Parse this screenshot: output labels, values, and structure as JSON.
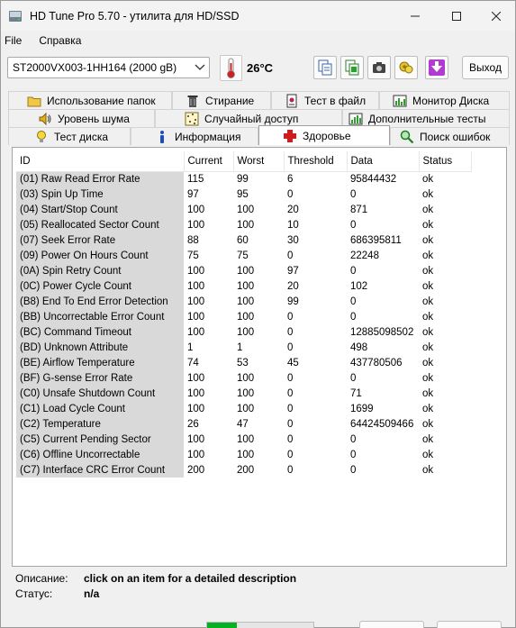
{
  "window": {
    "title": "HD Tune Pro 5.70 - утилита для HD/SSD"
  },
  "menu": {
    "file": "File",
    "help": "Справка"
  },
  "toolbar": {
    "drive": "ST2000VX003-1HH164 (2000 gB)",
    "temperature": "26°C",
    "exit_label": "Выход",
    "icons": [
      "copy-text-icon",
      "copy-screen-icon",
      "camera-icon",
      "options-icon",
      "save-down-icon"
    ]
  },
  "tabs": {
    "row1": [
      {
        "label": "Использование папок",
        "icon": "folder-icon"
      },
      {
        "label": "Стирание",
        "icon": "trash-icon"
      },
      {
        "label": "Тест в файл",
        "icon": "file-test-icon"
      },
      {
        "label": "Монитор Диска",
        "icon": "disk-monitor-icon"
      }
    ],
    "row2": [
      {
        "label": "Уровень шума",
        "icon": "speaker-icon"
      },
      {
        "label": "Случайный доступ",
        "icon": "random-access-icon"
      },
      {
        "label": "Дополнительные тесты",
        "icon": "extra-tests-icon"
      }
    ],
    "row3": [
      {
        "label": "Тест диска",
        "icon": "bulb-icon"
      },
      {
        "label": "Информация",
        "icon": "info-icon"
      },
      {
        "label": "Здоровье",
        "icon": "health-cross-icon"
      },
      {
        "label": "Поиск ошибок",
        "icon": "magnifier-icon"
      }
    ],
    "active": "Здоровье"
  },
  "smart": {
    "columns": [
      "ID",
      "Current",
      "Worst",
      "Threshold",
      "Data",
      "Status"
    ],
    "rows": [
      [
        "(01) Raw Read Error Rate",
        "115",
        "99",
        "6",
        "95844432",
        "ok"
      ],
      [
        "(03) Spin Up Time",
        "97",
        "95",
        "0",
        "0",
        "ok"
      ],
      [
        "(04) Start/Stop Count",
        "100",
        "100",
        "20",
        "871",
        "ok"
      ],
      [
        "(05) Reallocated Sector Count",
        "100",
        "100",
        "10",
        "0",
        "ok"
      ],
      [
        "(07) Seek Error Rate",
        "88",
        "60",
        "30",
        "686395811",
        "ok"
      ],
      [
        "(09) Power On Hours Count",
        "75",
        "75",
        "0",
        "22248",
        "ok"
      ],
      [
        "(0A) Spin Retry Count",
        "100",
        "100",
        "97",
        "0",
        "ok"
      ],
      [
        "(0C) Power Cycle Count",
        "100",
        "100",
        "20",
        "102",
        "ok"
      ],
      [
        "(B8) End To End Error Detection",
        "100",
        "100",
        "99",
        "0",
        "ok"
      ],
      [
        "(BB) Uncorrectable Error Count",
        "100",
        "100",
        "0",
        "0",
        "ok"
      ],
      [
        "(BC) Command Timeout",
        "100",
        "100",
        "0",
        "12885098502",
        "ok"
      ],
      [
        "(BD) Unknown Attribute",
        "1",
        "1",
        "0",
        "498",
        "ok"
      ],
      [
        "(BE) Airflow Temperature",
        "74",
        "53",
        "45",
        "437780506",
        "ok"
      ],
      [
        "(BF) G-sense Error Rate",
        "100",
        "100",
        "0",
        "0",
        "ok"
      ],
      [
        "(C0) Unsafe Shutdown Count",
        "100",
        "100",
        "0",
        "71",
        "ok"
      ],
      [
        "(C1) Load Cycle Count",
        "100",
        "100",
        "0",
        "1699",
        "ok"
      ],
      [
        "(C2) Temperature",
        "26",
        "47",
        "0",
        "64424509466",
        "ok"
      ],
      [
        "(C5) Current Pending Sector",
        "100",
        "100",
        "0",
        "0",
        "ok"
      ],
      [
        "(C6) Offline Uncorrectable",
        "100",
        "100",
        "0",
        "0",
        "ok"
      ],
      [
        "(C7) Interface CRC Error Count",
        "200",
        "200",
        "0",
        "0",
        "ok"
      ]
    ]
  },
  "details": {
    "desc_label": "Описание:",
    "desc_value": "click on an item for a detailed description",
    "status_label": "Статус:",
    "status_value": "n/a"
  },
  "statusbar": {
    "progress": 0.28
  }
}
